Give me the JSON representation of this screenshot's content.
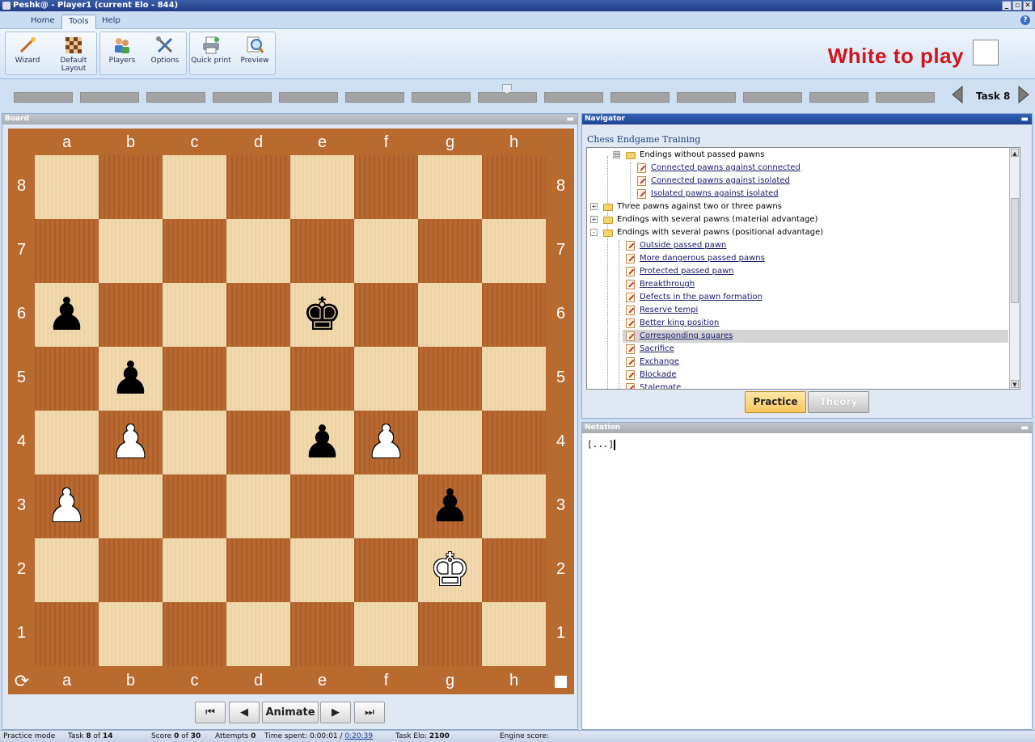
{
  "window": {
    "title": "Peshk@ - Player1 (current Elo - 844)",
    "buttons": [
      "_",
      "▫",
      "✕"
    ]
  },
  "ribbon": {
    "tabs": [
      "Home",
      "Tools",
      "Help"
    ],
    "active_tab": "Tools",
    "help_glyph": "?",
    "buttons": {
      "wizard": "Wizard",
      "default_layout_1": "Default",
      "default_layout_2": "Layout",
      "players": "Players",
      "options": "Options",
      "quick_print": "Quick print",
      "preview": "Preview"
    }
  },
  "to_play": "White to play",
  "taskbar": {
    "task_label": "Task 8",
    "total_segments": 14,
    "current_segment": 8
  },
  "board": {
    "title": "Board",
    "files": [
      "a",
      "b",
      "c",
      "d",
      "e",
      "f",
      "g",
      "h"
    ],
    "ranks": [
      "8",
      "7",
      "6",
      "5",
      "4",
      "3",
      "2",
      "1"
    ],
    "pieces": [
      {
        "square": "a6",
        "color": "b",
        "glyph": "♟"
      },
      {
        "square": "e6",
        "color": "b",
        "glyph": "♚"
      },
      {
        "square": "b5",
        "color": "b",
        "glyph": "♟"
      },
      {
        "square": "b4",
        "color": "w",
        "glyph": "♟"
      },
      {
        "square": "e4",
        "color": "b",
        "glyph": "♟"
      },
      {
        "square": "f4",
        "color": "w",
        "glyph": "♟"
      },
      {
        "square": "a3",
        "color": "w",
        "glyph": "♟"
      },
      {
        "square": "g3",
        "color": "b",
        "glyph": "♟"
      },
      {
        "square": "g2",
        "color": "w",
        "glyph": "♚"
      }
    ],
    "rotate_glyph": "⟳",
    "animate_label": "Animate",
    "nav_glyphs": {
      "first": "⏮",
      "prev": "◀",
      "next": "▶",
      "last": "⏭"
    }
  },
  "navigator": {
    "title": "Navigator",
    "root": "Chess Endgame Training",
    "items": [
      {
        "label": "Endings without passed pawns",
        "level": 2,
        "kind": "folder",
        "toggle": "⊟",
        "link": false,
        "selected": false
      },
      {
        "label": "Connected pawns against connected",
        "level": 3,
        "kind": "doc",
        "link": true,
        "selected": false
      },
      {
        "label": "Connected pawns against isolated",
        "level": 3,
        "kind": "doc",
        "link": true,
        "selected": false
      },
      {
        "label": "Isolated pawns against isolated",
        "level": 3,
        "kind": "doc",
        "link": true,
        "selected": false
      },
      {
        "label": "Three pawns against two or three pawns",
        "level": 1,
        "kind": "folder",
        "toggle": "+",
        "link": false,
        "selected": false
      },
      {
        "label": "Endings with several pawns (material advantage)",
        "level": 1,
        "kind": "folder",
        "toggle": "+",
        "link": false,
        "selected": false
      },
      {
        "label": "Endings with several pawns (positional advantage)",
        "level": 1,
        "kind": "folder",
        "toggle": "-",
        "link": false,
        "selected": false
      },
      {
        "label": "Outside passed pawn",
        "level": 2,
        "kind": "doc",
        "link": true,
        "selected": false
      },
      {
        "label": "More dangerous passed pawns",
        "level": 2,
        "kind": "doc",
        "link": true,
        "selected": false
      },
      {
        "label": "Protected passed pawn",
        "level": 2,
        "kind": "doc",
        "link": true,
        "selected": false
      },
      {
        "label": "Breakthrough",
        "level": 2,
        "kind": "doc",
        "link": true,
        "selected": false
      },
      {
        "label": "Defects in the pawn formation",
        "level": 2,
        "kind": "doc",
        "link": true,
        "selected": false
      },
      {
        "label": "Reserve tempi",
        "level": 2,
        "kind": "doc",
        "link": true,
        "selected": false
      },
      {
        "label": "Better king position",
        "level": 2,
        "kind": "doc",
        "link": true,
        "selected": false
      },
      {
        "label": "Corresponding squares",
        "level": 2,
        "kind": "doc",
        "link": true,
        "selected": true
      },
      {
        "label": "Sacrifice",
        "level": 2,
        "kind": "doc",
        "link": true,
        "selected": false
      },
      {
        "label": "Exchange",
        "level": 2,
        "kind": "doc",
        "link": true,
        "selected": false
      },
      {
        "label": "Blockade",
        "level": 2,
        "kind": "doc",
        "link": true,
        "selected": false
      },
      {
        "label": "Stalemate",
        "level": 2,
        "kind": "doc",
        "link": true,
        "selected": false
      }
    ],
    "practice_label": "Practice",
    "theory_label": "Theory"
  },
  "notation": {
    "title": "Notation",
    "text": "[...]"
  },
  "status": {
    "mode": "Practice mode",
    "task_prefix": "Task",
    "task_num": "8",
    "task_of": "of",
    "task_total": "14",
    "score_prefix": "Score",
    "score_num": "0",
    "score_of": "of",
    "score_total": "30",
    "attempts_prefix": "Attempts",
    "attempts_num": "0",
    "time_prefix": "Time spent: 0:00:01 /",
    "time_limit": "0:20:39",
    "elo_prefix": "Task Elo:",
    "elo_value": "2100",
    "engine_prefix": "Engine score:"
  }
}
